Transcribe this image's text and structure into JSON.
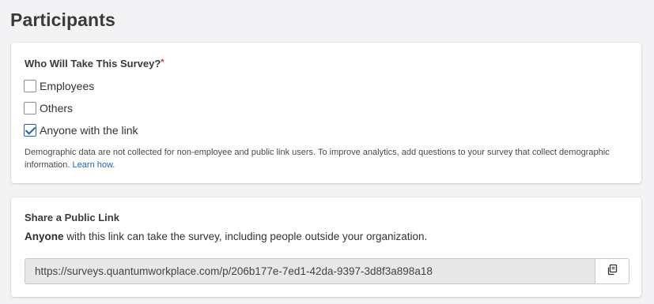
{
  "page": {
    "title": "Participants"
  },
  "who_section": {
    "heading": "Who Will Take This Survey?",
    "required_mark": "*",
    "options": [
      {
        "label": "Employees",
        "checked": false
      },
      {
        "label": "Others",
        "checked": false
      },
      {
        "label": "Anyone with the link",
        "checked": true
      }
    ],
    "help_text": "Demographic data are not collected for non-employee and public link users. To improve analytics, add questions to your survey that collect demographic information.",
    "learn_link": "Learn how."
  },
  "share_section": {
    "heading": "Share a Public Link",
    "desc_bold": "Anyone",
    "desc_rest": " with this link can take the survey, including people outside your organization.",
    "link_value": "https://surveys.quantumworkplace.com/p/206b177e-7ed1-42da-9397-3d8f3a898a18",
    "copy_icon": "copy-icon"
  },
  "colors": {
    "accent": "#1d64b8",
    "required": "#d23a3a",
    "background": "#f3f3f5"
  }
}
